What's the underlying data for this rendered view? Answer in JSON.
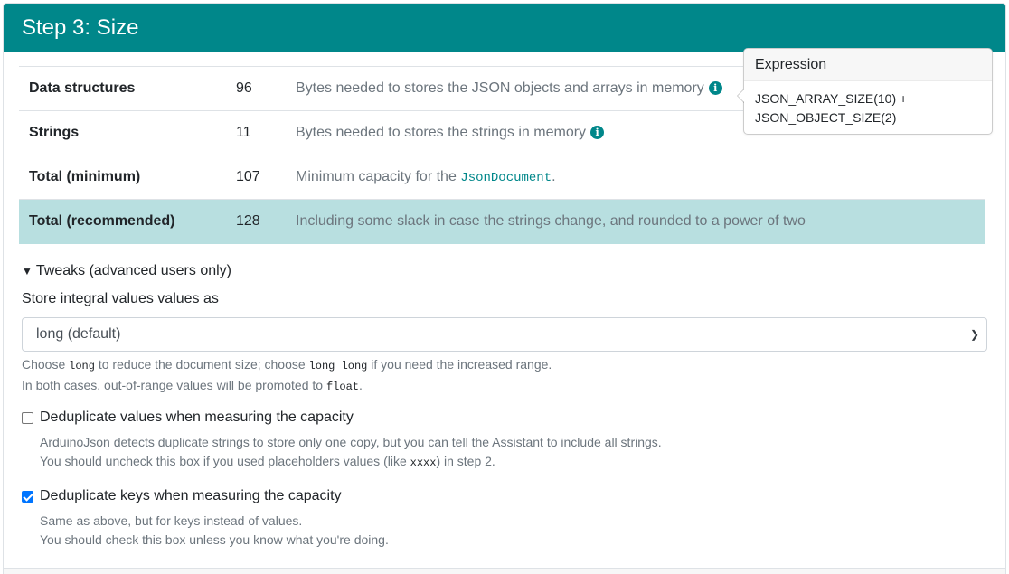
{
  "header": {
    "title": "Step 3: Size"
  },
  "table": {
    "rows": [
      {
        "label": "Data structures",
        "value": "96",
        "description": "Bytes needed to stores the JSON objects and arrays in memory"
      },
      {
        "label": "Strings",
        "value": "11",
        "description": "Bytes needed to stores the strings in memory"
      },
      {
        "label": "Total (minimum)",
        "value": "107",
        "description": "Minimum capacity for the",
        "code": "JsonDocument",
        "suffix": "."
      },
      {
        "label": "Total (recommended)",
        "value": "128",
        "description": "Including some slack in case the strings change, and rounded to a power of two"
      }
    ]
  },
  "popover": {
    "title": "Expression",
    "line1": "JSON_ARRAY_SIZE(10) +",
    "line2": "JSON_OBJECT_SIZE(2)"
  },
  "tweaks": {
    "summary": "Tweaks (advanced users only)",
    "store_label": "Store integral values values as",
    "select_value": "long (default)",
    "help1_a": "Choose",
    "help1_code1": "long",
    "help1_b": "to reduce the document size; choose",
    "help1_code2": "long long",
    "help1_c": "if you need the increased range.",
    "help2_a": "In both cases, out-of-range values will be promoted to",
    "help2_code": "float",
    "help2_b": "."
  },
  "dedup_values": {
    "label": "Deduplicate values when measuring the capacity",
    "checked": false,
    "line1": "ArduinoJson detects duplicate strings to store only one copy, but you can tell the Assistant to include all strings.",
    "line2_a": "You should uncheck this box if you used placeholders values (like",
    "line2_code": "xxxx",
    "line2_b": ") in step 2."
  },
  "dedup_keys": {
    "label": "Deduplicate keys when measuring the capacity",
    "checked": true,
    "line1": "Same as above, but for keys instead of values.",
    "line2": "You should check this box unless you know what you're doing."
  }
}
